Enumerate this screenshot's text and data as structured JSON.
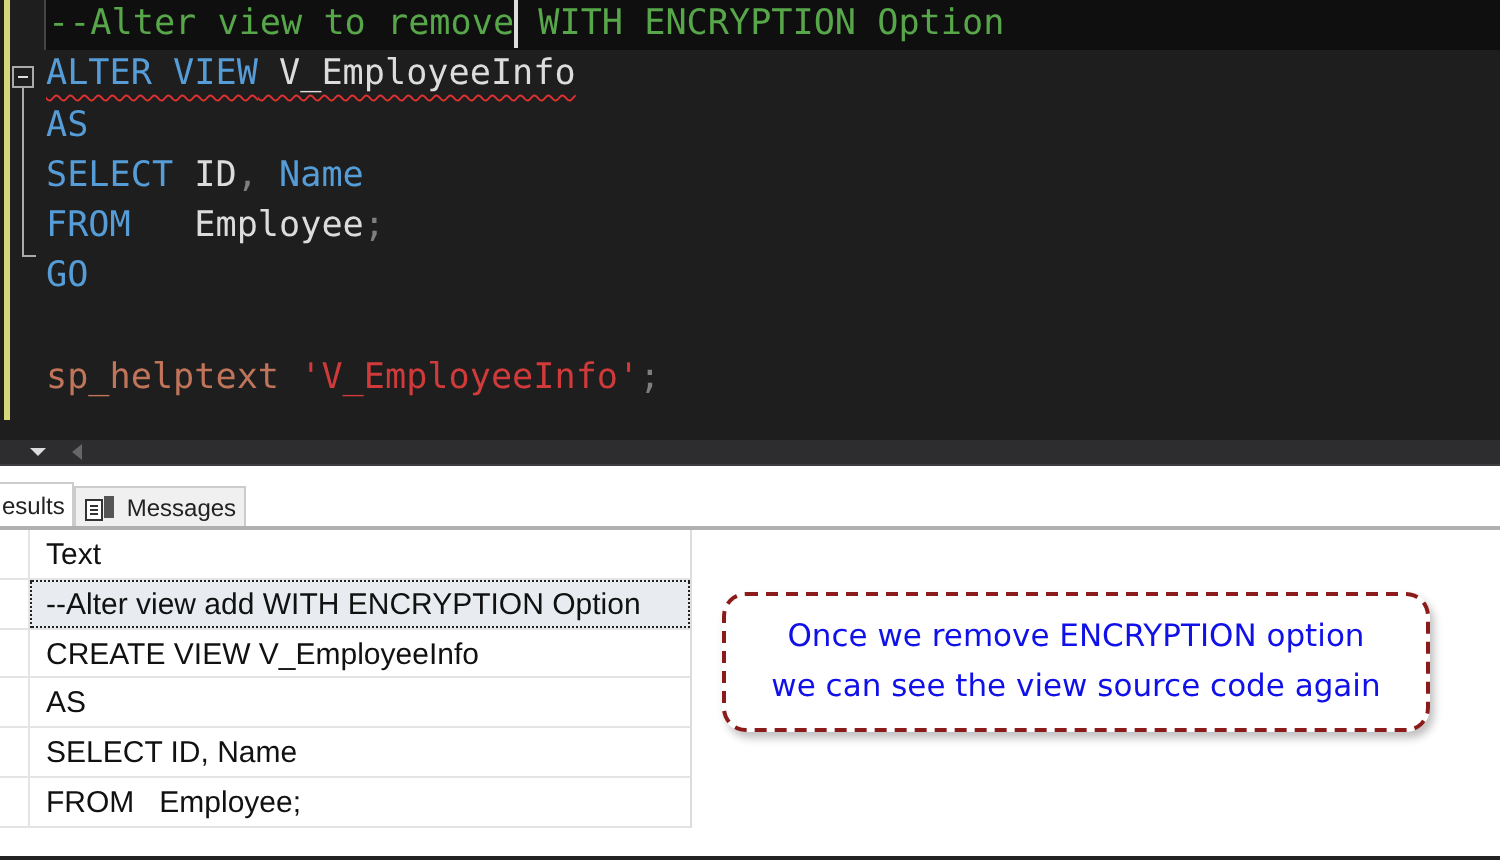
{
  "editor": {
    "lines": [
      {
        "current": true,
        "error": false,
        "tokens": [
          {
            "kind": "comment",
            "text": "--Alter view to remove"
          },
          {
            "kind": "caret"
          },
          {
            "kind": "comment",
            "text": " WITH ENCRYPTION Option"
          }
        ]
      },
      {
        "current": false,
        "error": true,
        "tokens": [
          {
            "kind": "keyword",
            "text": "ALTER VIEW"
          },
          {
            "kind": "plain",
            "text": " V_EmployeeInfo"
          }
        ]
      },
      {
        "current": false,
        "error": false,
        "tokens": [
          {
            "kind": "keyword",
            "text": "AS"
          }
        ]
      },
      {
        "current": false,
        "error": false,
        "tokens": [
          {
            "kind": "keyword",
            "text": "SELECT"
          },
          {
            "kind": "plain",
            "text": " ID"
          },
          {
            "kind": "punct",
            "text": ","
          },
          {
            "kind": "keyword",
            "text": " Name"
          }
        ]
      },
      {
        "current": false,
        "error": false,
        "tokens": [
          {
            "kind": "keyword",
            "text": "FROM"
          },
          {
            "kind": "plain",
            "text": "   Employee"
          },
          {
            "kind": "punct",
            "text": ";"
          }
        ]
      },
      {
        "current": false,
        "error": false,
        "tokens": [
          {
            "kind": "keyword",
            "text": "GO"
          }
        ]
      },
      {
        "current": false
      },
      {
        "current": false,
        "error": false,
        "tokens": [
          {
            "kind": "proc",
            "text": "sp_helptext"
          },
          {
            "kind": "string",
            "text": " 'V_EmployeeInfo'"
          },
          {
            "kind": "punct",
            "text": ";"
          }
        ]
      }
    ]
  },
  "result_tabs": [
    {
      "label": "esults",
      "selected": true
    },
    {
      "label": "Messages",
      "selected": false
    }
  ],
  "grid": {
    "columns": [
      "Text"
    ],
    "rows": [
      {
        "text": "--Alter view add WITH ENCRYPTION Option",
        "selected": true
      },
      {
        "text": "CREATE VIEW V_EmployeeInfo",
        "selected": false
      },
      {
        "text": "AS",
        "selected": false
      },
      {
        "text": "SELECT ID, Name",
        "selected": false
      },
      {
        "text": "FROM   Employee;",
        "selected": false
      }
    ]
  },
  "callout": {
    "lines": [
      "Once we remove ENCRYPTION option",
      "we can see the view source code again"
    ]
  }
}
